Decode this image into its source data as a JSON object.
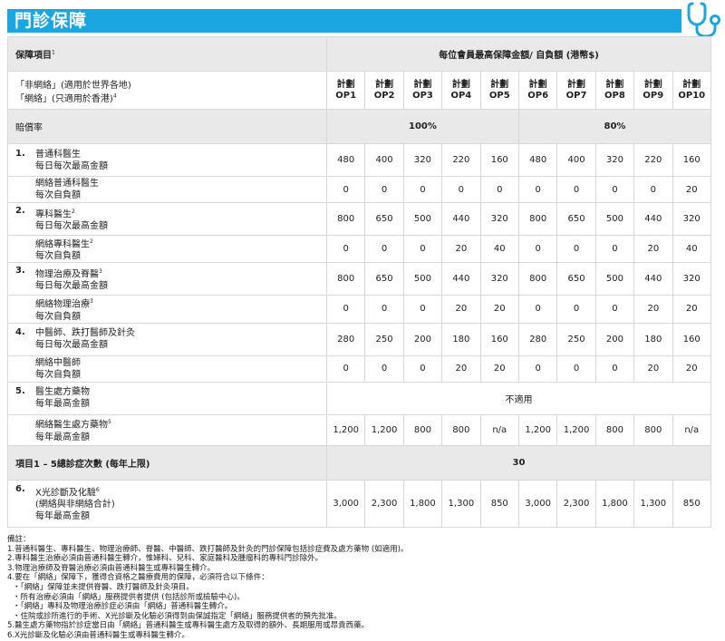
{
  "header": {
    "title": "門診保障"
  },
  "table": {
    "col_item_label": "保障項目",
    "col_item_sup": "1",
    "col_amount_label": "每位會員最高保障金額/ 自負額 (港幣$)",
    "network_line1": "「非網絡」(適用於世界各地)",
    "network_line2": "「網絡」(只適用於香港)",
    "network_sup": "4",
    "plans": [
      {
        "line1": "計劃",
        "line2": "OP1"
      },
      {
        "line1": "計劃",
        "line2": "OP2"
      },
      {
        "line1": "計劃",
        "line2": "OP3"
      },
      {
        "line1": "計劃",
        "line2": "OP4"
      },
      {
        "line1": "計劃",
        "line2": "OP5"
      },
      {
        "line1": "計劃",
        "line2": "OP6"
      },
      {
        "line1": "計劃",
        "line2": "OP7"
      },
      {
        "line1": "計劃",
        "line2": "OP8"
      },
      {
        "line1": "計劃",
        "line2": "OP9"
      },
      {
        "line1": "計劃",
        "line2": "OP10"
      }
    ],
    "rate_label": "賠償率",
    "rate_a": "100%",
    "rate_b": "80%",
    "items": [
      {
        "no": "1.",
        "a_title": "普通科醫生",
        "a_sup": "",
        "a_sub": "每日每次最高金額",
        "a_values": [
          "480",
          "400",
          "320",
          "220",
          "160",
          "480",
          "400",
          "320",
          "220",
          "160"
        ],
        "b_title": "網絡普通科醫生",
        "b_sup": "",
        "b_sub": "每次自負額",
        "b_values": [
          "0",
          "0",
          "0",
          "0",
          "0",
          "0",
          "0",
          "0",
          "0",
          "20"
        ]
      },
      {
        "no": "2.",
        "a_title": "專科醫生",
        "a_sup": "2",
        "a_sub": "每日每次最高金額",
        "a_values": [
          "800",
          "650",
          "500",
          "440",
          "320",
          "800",
          "650",
          "500",
          "440",
          "320"
        ],
        "b_title": "網絡專科醫生",
        "b_sup": "2",
        "b_sub": "每次自負額",
        "b_values": [
          "0",
          "0",
          "0",
          "20",
          "40",
          "0",
          "0",
          "0",
          "20",
          "40"
        ]
      },
      {
        "no": "3.",
        "a_title": "物理治療及脊醫",
        "a_sup": "3",
        "a_sub": "每日每次最高金額",
        "a_values": [
          "800",
          "650",
          "500",
          "440",
          "320",
          "800",
          "650",
          "500",
          "440",
          "320"
        ],
        "b_title": "網絡物理治療",
        "b_sup": "3",
        "b_sub": "每次自負額",
        "b_values": [
          "0",
          "0",
          "0",
          "20",
          "20",
          "0",
          "0",
          "0",
          "20",
          "20"
        ]
      },
      {
        "no": "4.",
        "a_title": "中醫師、跌打醫師及針灸",
        "a_sup": "",
        "a_sub": "每日每次最高金額",
        "a_values": [
          "280",
          "250",
          "200",
          "180",
          "160",
          "280",
          "250",
          "200",
          "180",
          "160"
        ],
        "b_title": "網絡中醫師",
        "b_sup": "",
        "b_sub": "每次自負額",
        "b_values": [
          "0",
          "0",
          "0",
          "20",
          "20",
          "0",
          "0",
          "0",
          "20",
          "20"
        ]
      }
    ],
    "item5": {
      "no": "5.",
      "a_title": "醫生處方藥物",
      "a_sub": "每年最高金額",
      "a_value": "不適用",
      "b_title": "網絡醫生處方藥物",
      "b_sup": "5",
      "b_sub": "每年最高金額",
      "b_values": [
        "1,200",
        "1,200",
        "800",
        "800",
        "n/a",
        "1,200",
        "1,200",
        "800",
        "800",
        "n/a"
      ]
    },
    "visits_label": "項目1 – 5總診症次數 (每年上限)",
    "visits_value": "30",
    "item6": {
      "no": "6.",
      "title": "X光診斷及化驗",
      "sup": "6",
      "line2": "(網絡與非網絡合計)",
      "line3": "每年最高金額",
      "values": [
        "3,000",
        "2,300",
        "1,800",
        "1,300",
        "850",
        "3,000",
        "2,300",
        "1,800",
        "1,300",
        "850"
      ]
    }
  },
  "notes": {
    "heading": "備註：",
    "lines": [
      "1.普通科醫生、專科醫生、物理治療師、脊醫、中醫師、跌打醫師及針灸的門診保障包括診症費及處方藥物 (如適用)。",
      "2.專科醫生治療必須由普通科醫生轉介，惟婦科、兒科、家庭醫科及腫瘤科的專科門診除外。",
      "3.物理治療師及脊醫治療必須由普通科醫生或專科醫生轉介。",
      "4.要在「網絡」保障下，獲得合資格之醫療費用的保障，必須符合以下條件：",
      "・「網絡」保障並未提供脊醫、跌打醫師及針灸項目。",
      "・所有治療必須由「網絡」服務提供者提供 (包括診所或檢驗中心)。",
      "・「網絡」專科及物理治療診症必須由「網絡」普通科醫生轉介。",
      "・住院或診所進行的手術、X光診斷及化驗必須得到由保誠指定「網絡」服務提供者的預先批准。",
      "5.醫生處方藥物指於診症當日由「網絡」普通科醫生或專科醫生處方及取得的額外、長期服用或昂貴西藥。",
      "6.X光診斷及化驗必須由普通科醫生或專科醫生轉介。"
    ],
    "indented": [
      false,
      false,
      false,
      false,
      true,
      true,
      true,
      true,
      false,
      false
    ]
  }
}
